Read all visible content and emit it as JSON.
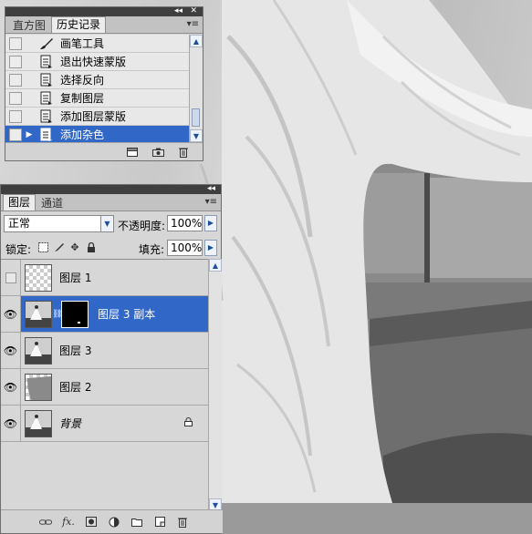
{
  "history": {
    "tabs": [
      "直方图",
      "历史记录"
    ],
    "steps": [
      {
        "label": "画笔工具",
        "icon": "brush-icon",
        "selected": false
      },
      {
        "label": "退出快速蒙版",
        "icon": "history-step-icon",
        "selected": false
      },
      {
        "label": "选择反向",
        "icon": "history-step-icon",
        "selected": false
      },
      {
        "label": "复制图层",
        "icon": "history-step-icon",
        "selected": false
      },
      {
        "label": "添加图层蒙版",
        "icon": "history-step-icon",
        "selected": false
      },
      {
        "label": "添加杂色",
        "icon": "history-step-icon",
        "selected": true
      }
    ],
    "footer_icons": [
      "new-document-from-state-icon",
      "snapshot-camera-icon",
      "trash-icon"
    ]
  },
  "layers": {
    "tabs": [
      "图层",
      "通道"
    ],
    "blend_mode": "正常",
    "opacity_label": "不透明度:",
    "opacity_value": "100%",
    "lock_label": "锁定:",
    "lock_icons": [
      "lock-transparent-icon",
      "lock-paint-icon",
      "lock-move-icon",
      "lock-all-icon"
    ],
    "fill_label": "填充:",
    "fill_value": "100%",
    "items": [
      {
        "name": "图层 1",
        "visible": false,
        "thumb": "transparent",
        "selected": false
      },
      {
        "name": "图层 3 副本",
        "visible": true,
        "thumb": "photo",
        "has_mask": true,
        "selected": true
      },
      {
        "name": "图层 3",
        "visible": true,
        "thumb": "photo",
        "selected": false
      },
      {
        "name": "图层 2",
        "visible": true,
        "thumb": "grey",
        "selected": false
      },
      {
        "name": "背景",
        "visible": true,
        "thumb": "photo",
        "locked": true,
        "selected": false
      }
    ],
    "footer_icons": [
      "link-layers-icon",
      "layer-style-fx-icon",
      "add-mask-icon",
      "adjustment-layer-icon",
      "new-group-icon",
      "new-layer-icon",
      "delete-layer-icon"
    ]
  },
  "colors": {
    "selection": "#3168c8",
    "panel_bg": "#d6d6d6",
    "title_bar": "#3f3f3f"
  }
}
